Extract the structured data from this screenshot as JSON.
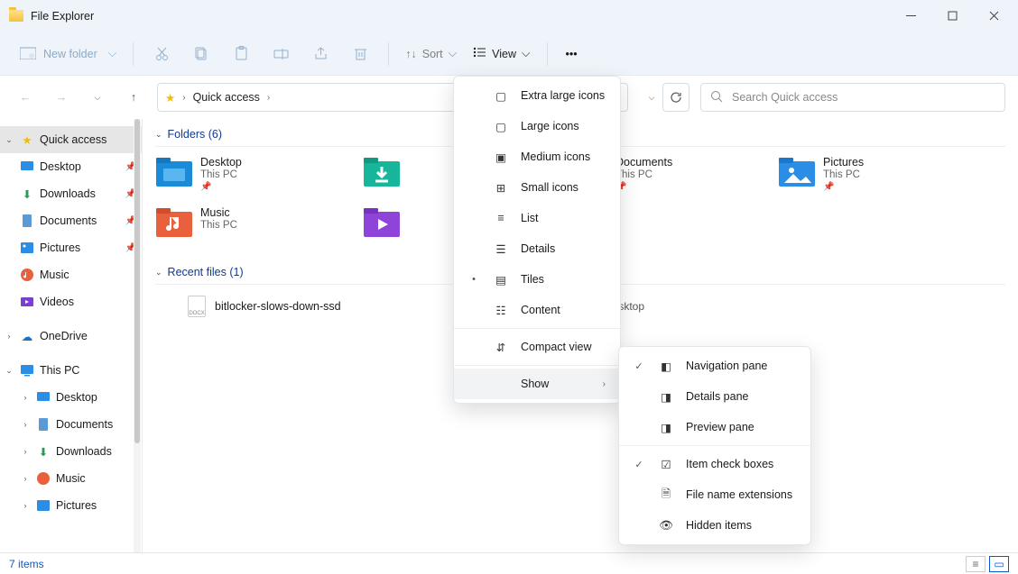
{
  "window": {
    "title": "File Explorer"
  },
  "ribbon": {
    "newFolder": "New folder",
    "sort": "Sort",
    "view": "View"
  },
  "breadcrumb": {
    "root": "Quick access"
  },
  "search": {
    "placeholder": "Search Quick access"
  },
  "sidebar": {
    "quickAccess": "Quick access",
    "desktop": "Desktop",
    "downloads": "Downloads",
    "documents": "Documents",
    "pictures": "Pictures",
    "music": "Music",
    "videos": "Videos",
    "oneDrive": "OneDrive",
    "thisPC": "This PC",
    "pcDesktop": "Desktop",
    "pcDocuments": "Documents",
    "pcDownloads": "Downloads",
    "pcMusic": "Music",
    "pcPictures": "Pictures"
  },
  "groups": {
    "foldersHeader": "Folders (6)",
    "recentHeader": "Recent files (1)"
  },
  "folders": [
    {
      "name": "Desktop",
      "sub": "This PC"
    },
    {
      "name": "",
      "sub": ""
    },
    {
      "name": "Documents",
      "sub": "This PC"
    },
    {
      "name": "Pictures",
      "sub": "This PC"
    },
    {
      "name": "Music",
      "sub": "This PC"
    },
    {
      "name": "",
      "sub": ""
    }
  ],
  "recent": {
    "name": "bitlocker-slows-down-ssd",
    "path": "This PC\\Desktop"
  },
  "viewMenu": {
    "extraLarge": "Extra large icons",
    "large": "Large icons",
    "medium": "Medium icons",
    "small": "Small icons",
    "list": "List",
    "details": "Details",
    "tiles": "Tiles",
    "content": "Content",
    "compact": "Compact view",
    "show": "Show"
  },
  "showMenu": {
    "nav": "Navigation pane",
    "details": "Details pane",
    "preview": "Preview pane",
    "checkboxes": "Item check boxes",
    "ext": "File name extensions",
    "hidden": "Hidden items"
  },
  "status": {
    "items": "7 items"
  }
}
